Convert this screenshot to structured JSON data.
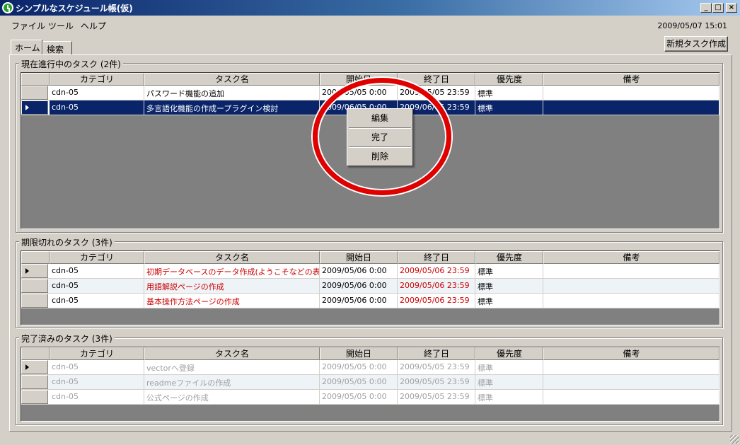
{
  "window": {
    "title": "シンプルなスケジュール帳(仮)",
    "controls": {
      "minimize": "_",
      "maximize": "□",
      "close": "×"
    }
  },
  "menubar": {
    "items": [
      "ファイル",
      "ツール",
      "ヘルプ"
    ],
    "datetime": "2009/05/07 15:01"
  },
  "tabs": [
    "ホーム",
    "検索"
  ],
  "new_task_button": "新規タスク作成",
  "columns": [
    "カテゴリ",
    "タスク名",
    "開始日",
    "終了日",
    "優先度",
    "備考"
  ],
  "sections": {
    "current": {
      "title": "現在進行中のタスク (2件)",
      "rows": [
        {
          "category": "cdn-05",
          "task": "パスワード機能の追加",
          "start": "2009/05/05 0:00",
          "end": "2009/05/05 23:59",
          "priority": "標準",
          "note": ""
        },
        {
          "category": "cdn-05",
          "task": "多言語化機能の作成ープラグイン検討",
          "start": "2009/06/05 0:00",
          "end": "2009/06/05 23:59",
          "priority": "標準",
          "note": ""
        }
      ]
    },
    "overdue": {
      "title": "期限切れのタスク (3件)",
      "rows": [
        {
          "category": "cdn-05",
          "task": "初期データベースのデータ作成(ようこそなどの表示...",
          "start": "2009/05/06 0:00",
          "end": "2009/05/06 23:59",
          "priority": "標準",
          "note": ""
        },
        {
          "category": "cdn-05",
          "task": "用語解説ページの作成",
          "start": "2009/05/06 0:00",
          "end": "2009/05/06 23:59",
          "priority": "標準",
          "note": ""
        },
        {
          "category": "cdn-05",
          "task": "基本操作方法ページの作成",
          "start": "2009/05/06 0:00",
          "end": "2009/05/06 23:59",
          "priority": "標準",
          "note": ""
        }
      ]
    },
    "completed": {
      "title": "完了済みのタスク (3件)",
      "rows": [
        {
          "category": "cdn-05",
          "task": "vectorへ登録",
          "start": "2009/05/05 0:00",
          "end": "2009/05/05 23:59",
          "priority": "標準",
          "note": ""
        },
        {
          "category": "cdn-05",
          "task": "readmeファイルの作成",
          "start": "2009/05/05 0:00",
          "end": "2009/05/05 23:59",
          "priority": "標準",
          "note": ""
        },
        {
          "category": "cdn-05",
          "task": "公式ページの作成",
          "start": "2009/05/05 0:00",
          "end": "2009/05/05 23:59",
          "priority": "標準",
          "note": ""
        }
      ]
    }
  },
  "context_menu": [
    "編集",
    "完了",
    "削除"
  ],
  "colors": {
    "titlebar_start": "#0a246a",
    "selection": "#0a246a",
    "overdue_text": "#cc0000",
    "completed_text": "#a0a0a0",
    "highlight_ring": "#e00000"
  }
}
